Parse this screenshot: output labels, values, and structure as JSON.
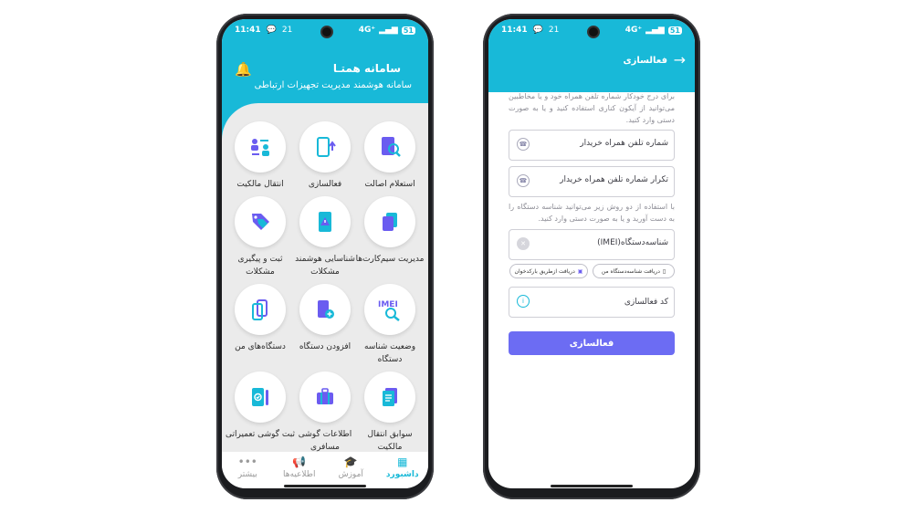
{
  "status": {
    "time": "11:41",
    "notif_count": "21",
    "network": "4G⁺",
    "battery": "51"
  },
  "dashboard": {
    "app_title": "سامانه همتـا",
    "app_subtitle": "سامانه هوشمند مدیریت تجهیزات ارتباطی",
    "tiles": [
      {
        "label": "استعلام اصالت",
        "icon": "phone-search-icon"
      },
      {
        "label": "فعالسازی",
        "icon": "phone-activate-icon"
      },
      {
        "label": "انتقال مالکیت",
        "icon": "ownership-transfer-icon"
      },
      {
        "label": "مدیریت سیم‌کارت‌ها",
        "icon": "sim-cards-icon"
      },
      {
        "label": "شناسایی هوشمند مشکلات",
        "icon": "phone-alert-icon"
      },
      {
        "label": "ثبت و پیگیری مشکلات",
        "icon": "tag-icon"
      },
      {
        "label": "وضعیت شناسه دستگاه",
        "icon": "imei-search-icon"
      },
      {
        "label": "افزودن دستگاه",
        "icon": "add-device-icon"
      },
      {
        "label": "دستگاه‌های من",
        "icon": "my-devices-icon"
      },
      {
        "label": "سوابق انتقال مالکیت",
        "icon": "documents-icon"
      },
      {
        "label": "اطلاعات گوشی مسافری",
        "icon": "luggage-icon"
      },
      {
        "label": "ثبت گوشی تعمیراتی",
        "icon": "repair-phone-icon"
      }
    ],
    "tabs": [
      {
        "label": "داشبورد",
        "icon": "grid-icon"
      },
      {
        "label": "آموزش",
        "icon": "graduation-cap-icon"
      },
      {
        "label": "اطلاعیه‌ها",
        "icon": "megaphone-icon"
      },
      {
        "label": "بیشتر",
        "icon": "more-dots-icon"
      }
    ]
  },
  "activation": {
    "title": "فعالسازی",
    "note1": "برای درج خودکار شماره تلفن همراه خود و یا مخاطبین می‌توانید از آیکون کناری استفاده کنید و یا به صورت دستی وارد کنید.",
    "buyer_phone": "شماره تلفن همراه خریدار",
    "buyer_phone_repeat": "تکرار شماره تلفن همراه خریدار",
    "note2": "با استفاده از دو روش زیر می‌توانید شناسه دستگاه را به دست آورید و یا به صورت دستی وارد کنید.",
    "imei_label": "شناسه‌دستگاه(IMEI)",
    "chip_my_device": "دریافت شناسه‌دستگاه من",
    "chip_barcode": "دریافت از‌طریق بارکدخوان",
    "activation_code": "کد فعالسازی",
    "submit": "فعالسازی"
  },
  "colors": {
    "accent": "#18b9d8",
    "button": "#6c6cf3",
    "icon_purple": "#6a5cf0"
  }
}
